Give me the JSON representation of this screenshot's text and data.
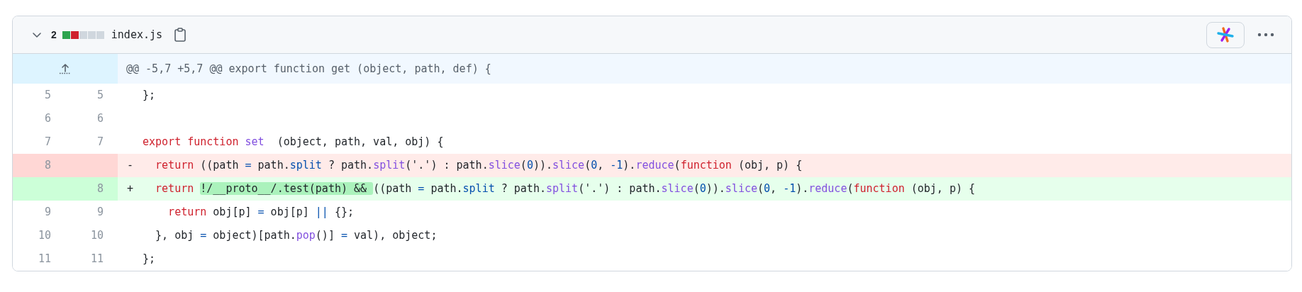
{
  "file": {
    "expanded": true,
    "changes": "2",
    "diffstat": [
      {
        "color": "#2da44e"
      },
      {
        "color": "#cf222e"
      },
      {
        "color": "#d0d7de"
      },
      {
        "color": "#d0d7de"
      },
      {
        "color": "#d0d7de"
      }
    ],
    "name": "index.js"
  },
  "hunk": {
    "header": "@@ -5,7 +5,7 @@ export function get (object, path, def) {"
  },
  "lines": [
    {
      "kind": "context",
      "old": "5",
      "new": "5",
      "tokens": [
        {
          "kind": "plain",
          "text": "};"
        }
      ]
    },
    {
      "kind": "context",
      "old": "6",
      "new": "6"
    },
    {
      "kind": "context",
      "old": "7",
      "new": "7",
      "tokens": [
        {
          "kind": "keyword",
          "text": "export"
        },
        {
          "kind": "keyword",
          "text": " function"
        },
        {
          "kind": "call",
          "text": " set"
        },
        {
          "kind": "plain",
          "text": "  (object, path, val, obj) {"
        }
      ]
    },
    {
      "kind": "deleted",
      "old": "8",
      "sign": "-",
      "tokens": [
        {
          "kind": "keyword",
          "text": "  return"
        },
        {
          "kind": "plain",
          "text": " ((path "
        },
        {
          "kind": "constant",
          "text": "="
        },
        {
          "kind": "plain",
          "text": " path."
        },
        {
          "kind": "constant",
          "text": "split"
        },
        {
          "kind": "plain",
          "text": " ? path."
        },
        {
          "kind": "call",
          "text": "split"
        },
        {
          "kind": "plain",
          "text": "('.') : path."
        },
        {
          "kind": "call",
          "text": "slice"
        },
        {
          "kind": "plain",
          "text": "("
        },
        {
          "kind": "constant",
          "text": "0"
        },
        {
          "kind": "plain",
          "text": "))."
        },
        {
          "kind": "call",
          "text": "slice"
        },
        {
          "kind": "plain",
          "text": "("
        },
        {
          "kind": "constant",
          "text": "0"
        },
        {
          "kind": "plain",
          "text": ", "
        },
        {
          "kind": "constant",
          "text": "-1"
        },
        {
          "kind": "plain",
          "text": ")."
        },
        {
          "kind": "call",
          "text": "reduce"
        },
        {
          "kind": "plain",
          "text": "("
        },
        {
          "kind": "keyword",
          "text": "function"
        },
        {
          "kind": "plain",
          "text": " (obj, p) {"
        }
      ]
    },
    {
      "kind": "added",
      "new": "8",
      "sign": "+",
      "tokens": [
        {
          "kind": "keyword",
          "text": "  return "
        },
        {
          "kind": "highlight",
          "text": "!/__proto__/.test(path) && "
        },
        {
          "kind": "plain",
          "text": "((path "
        },
        {
          "kind": "constant",
          "text": "="
        },
        {
          "kind": "plain",
          "text": " path."
        },
        {
          "kind": "constant",
          "text": "split"
        },
        {
          "kind": "plain",
          "text": " ? path."
        },
        {
          "kind": "call",
          "text": "split"
        },
        {
          "kind": "plain",
          "text": "('.') : path."
        },
        {
          "kind": "call",
          "text": "slice"
        },
        {
          "kind": "plain",
          "text": "("
        },
        {
          "kind": "constant",
          "text": "0"
        },
        {
          "kind": "plain",
          "text": "))."
        },
        {
          "kind": "call",
          "text": "slice"
        },
        {
          "kind": "plain",
          "text": "("
        },
        {
          "kind": "constant",
          "text": "0"
        },
        {
          "kind": "plain",
          "text": ", "
        },
        {
          "kind": "constant",
          "text": "-1"
        },
        {
          "kind": "plain",
          "text": ")."
        },
        {
          "kind": "call",
          "text": "reduce"
        },
        {
          "kind": "plain",
          "text": "("
        },
        {
          "kind": "keyword",
          "text": "function"
        },
        {
          "kind": "plain",
          "text": " (obj, p) {"
        }
      ]
    },
    {
      "kind": "context",
      "old": "9",
      "new": "9",
      "tokens": [
        {
          "kind": "keyword",
          "text": "    return"
        },
        {
          "kind": "plain",
          "text": " obj[p] "
        },
        {
          "kind": "constant",
          "text": "="
        },
        {
          "kind": "plain",
          "text": " obj[p] "
        },
        {
          "kind": "constant",
          "text": "||"
        },
        {
          "kind": "plain",
          "text": " {};"
        }
      ]
    },
    {
      "kind": "context",
      "old": "10",
      "new": "10",
      "tokens": [
        {
          "kind": "plain",
          "text": "  }, obj "
        },
        {
          "kind": "constant",
          "text": "="
        },
        {
          "kind": "plain",
          "text": " object)[path."
        },
        {
          "kind": "call",
          "text": "pop"
        },
        {
          "kind": "plain",
          "text": "()] "
        },
        {
          "kind": "constant",
          "text": "="
        },
        {
          "kind": "plain",
          "text": " val), object;"
        }
      ]
    },
    {
      "kind": "context",
      "old": "11",
      "new": "11",
      "tokens": [
        {
          "kind": "plain",
          "text": "};"
        }
      ]
    }
  ]
}
